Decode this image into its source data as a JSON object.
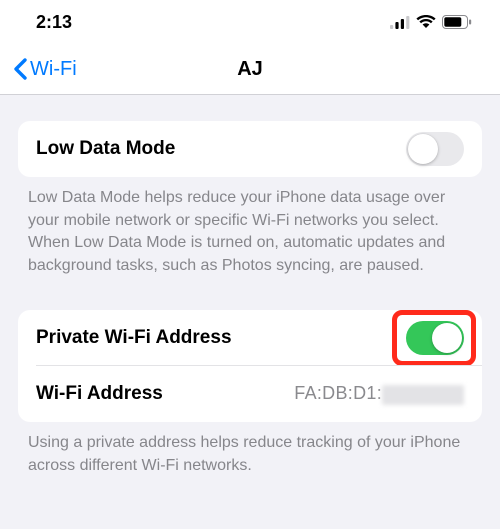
{
  "status": {
    "time": "2:13"
  },
  "nav": {
    "back_label": "Wi-Fi",
    "title": "AJ"
  },
  "low_data": {
    "label": "Low Data Mode",
    "enabled": false,
    "footer": "Low Data Mode helps reduce your iPhone data usage over your mobile network or specific Wi-Fi networks you select. When Low Data Mode is turned on, automatic updates and background tasks, such as Photos syncing, are paused."
  },
  "private_addr": {
    "label": "Private Wi-Fi Address",
    "enabled": true,
    "addr_label": "Wi-Fi Address",
    "addr_value": "FA:DB:D1:",
    "footer": "Using a private address helps reduce tracking of your iPhone across different Wi-Fi networks."
  }
}
